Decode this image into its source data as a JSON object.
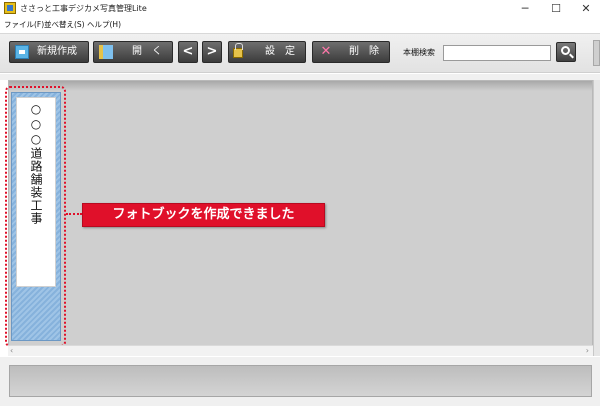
{
  "window": {
    "title": "ささっと工事デジカメ写真管理Lite",
    "controls": {
      "minimize": "─",
      "maximize": "☐",
      "close": "✕"
    }
  },
  "menu": {
    "items": [
      {
        "label": "ファイル(F)"
      },
      {
        "label": "並べ替え(S)"
      },
      {
        "label": "ヘルプ(H)"
      }
    ]
  },
  "toolbar": {
    "new_label": "新規作成",
    "open_label": "開　く",
    "prev_label": "<",
    "next_label": ">",
    "settings_label": "設　定",
    "delete_label": "削　除",
    "search_label": "本棚検索",
    "search_value": "",
    "icons": {
      "new": "new-book-icon",
      "open": "open-book-icon",
      "settings": "lock-icon",
      "delete": "delete-x-icon",
      "search": "magnifier-icon"
    }
  },
  "bookshelf": {
    "books": [
      {
        "title": "○○○道路舗装工事"
      }
    ],
    "scroll": {
      "left_arrow": "‹",
      "right_arrow": "›"
    }
  },
  "callout": {
    "text": "フォトブックを作成できました",
    "color": "#e0102a"
  },
  "colors": {
    "book_cover": "#9fc4e6",
    "toolbar_button": "#4a4a4a",
    "highlight": "#e0102a"
  }
}
